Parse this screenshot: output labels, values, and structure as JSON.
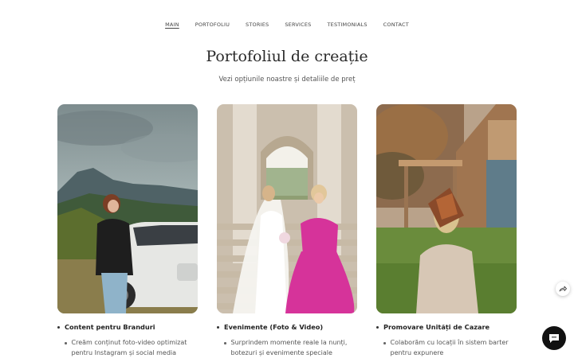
{
  "nav": {
    "items": [
      "MAIN",
      "PORTOFOLIU",
      "STORIES",
      "SERVICES",
      "TESTIMONIALS",
      "CONTACT"
    ]
  },
  "header": {
    "title": "Portofoliul de creație",
    "subtitle": "Vezi opțiunile noastre și detaliile de preț"
  },
  "cards": [
    {
      "heading": "Content pentru Branduri",
      "text": "Creăm conținut foto-video optimizat pentru Instagram și social media"
    },
    {
      "heading": "Evenimente (Foto & Video)",
      "text": "Surprindem momente reale la nunți, botezuri și evenimente speciale"
    },
    {
      "heading": "Promovare Unități de Cazare",
      "text": "Colaborăm cu locații în sistem barter pentru expunere"
    }
  ],
  "colors": {
    "chat_button": "#111111",
    "pink_dress": "#d6339a"
  },
  "icons": {
    "share": "share-arrow-icon",
    "chat": "chat-bubble-icon"
  }
}
